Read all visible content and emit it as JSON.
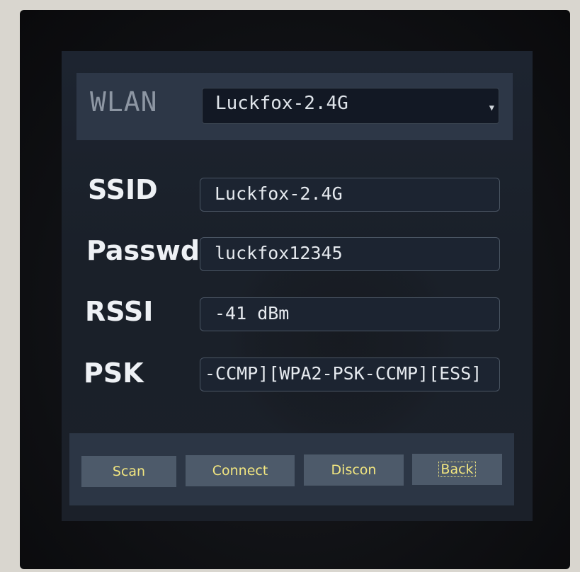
{
  "wlan": {
    "label": "WLAN",
    "selected_network": "Luckfox-2.4G"
  },
  "fields": {
    "ssid": {
      "label": "SSID",
      "value": "Luckfox-2.4G"
    },
    "passwd": {
      "label": "Passwd",
      "value": "luckfox12345"
    },
    "rssi": {
      "label": "RSSI",
      "value": "-41 dBm"
    },
    "psk": {
      "label": "PSK",
      "value": "-CCMP][WPA2-PSK-CCMP][ESS]"
    }
  },
  "buttons": {
    "scan": "Scan",
    "connect": "Connect",
    "discon": "Discon",
    "back": "Back"
  },
  "icons": {
    "dropdown": "chevron-down-icon"
  },
  "colors": {
    "button_text": "#f2e680",
    "button_bg": "#4d5a6a",
    "panel_bg": "#2d3747"
  }
}
